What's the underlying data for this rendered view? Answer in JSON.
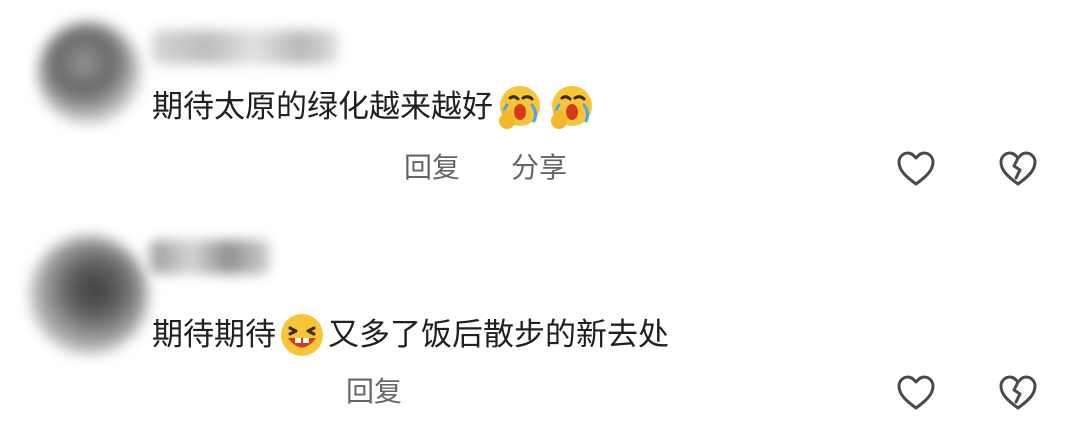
{
  "comments": [
    {
      "text_part1": "期待太原的绿化越来越好",
      "text_part2": "",
      "emojis": [
        "crying-laugh-face-emoji",
        "crying-laugh-face-emoji"
      ],
      "actions": {
        "reply_label": "回复",
        "share_label": "分享"
      },
      "icons": [
        "heart-outline-icon",
        "broken-heart-outline-icon"
      ]
    },
    {
      "text_part1": "期待期待",
      "text_part2": "又多了饭后散步的新去处",
      "emojis": [
        "laughing-face-emoji"
      ],
      "actions": {
        "reply_label": "回复"
      },
      "icons": [
        "heart-outline-icon",
        "broken-heart-outline-icon"
      ]
    }
  ],
  "colors": {
    "text": "#202020",
    "action_text": "#666666",
    "icon_stroke": "#4a4a4a",
    "emoji_yellow": "#f7c536",
    "emoji_mouth": "#d63a1f"
  }
}
